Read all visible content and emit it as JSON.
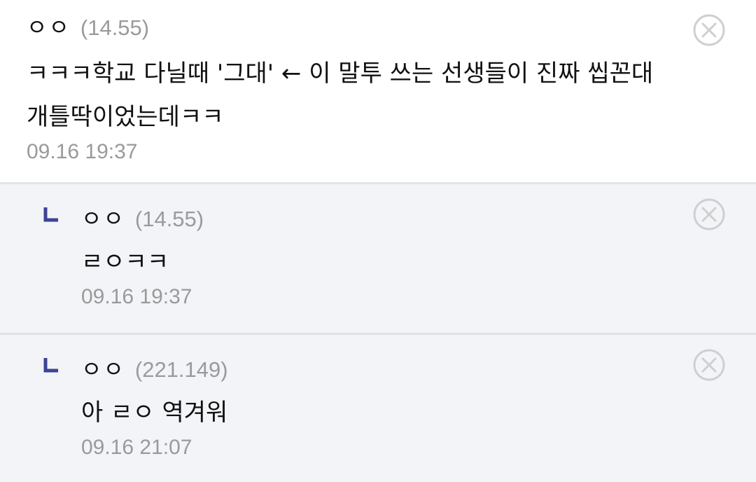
{
  "comments": [
    {
      "author": "ㅇㅇ",
      "ip": "(14.55)",
      "body": "ㅋㅋㅋ학교 다닐때 '그대' ← 이 말투 쓰는 선생들이 진짜 씹꼰대 개틀딱이었는데ㅋㅋ",
      "time": "09.16 19:37",
      "delete_icon": "close-circle-icon"
    }
  ],
  "replies": [
    {
      "marker_icon": "reply-corner-icon",
      "author": "ㅇㅇ",
      "ip": "(14.55)",
      "body": "ㄹㅇㅋㅋ",
      "time": "09.16 19:37",
      "delete_icon": "close-circle-icon"
    },
    {
      "marker_icon": "reply-corner-icon",
      "author": "ㅇㅇ",
      "ip": "(221.149)",
      "body": "아 ㄹㅇ 역겨워",
      "time": "09.16 21:07",
      "delete_icon": "close-circle-icon"
    }
  ],
  "colors": {
    "reply_marker": "#3d4394",
    "delete_icon": "#cfcfcf",
    "meta_text": "#9a9a9a",
    "reply_background": "#f3f4f8",
    "divider": "#e2e3e8"
  }
}
